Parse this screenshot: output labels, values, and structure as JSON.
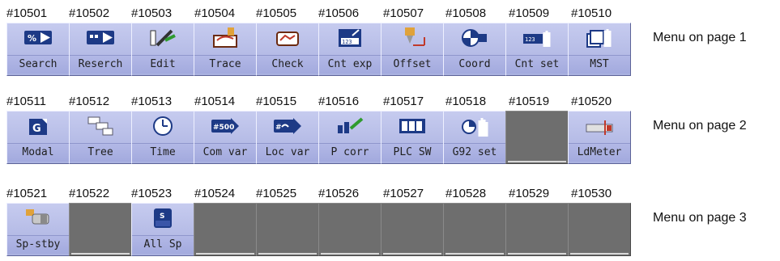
{
  "pages": [
    {
      "ids": [
        "#10501",
        "#10502",
        "#10503",
        "#10504",
        "#10505",
        "#10506",
        "#10507",
        "#10508",
        "#10509",
        "#10510"
      ],
      "caption": "Menu on page 1",
      "buttons": [
        {
          "label": "Search",
          "icon": "search-icon",
          "empty": false
        },
        {
          "label": "Reserch",
          "icon": "research-icon",
          "empty": false
        },
        {
          "label": "Edit",
          "icon": "edit-icon",
          "empty": false
        },
        {
          "label": "Trace",
          "icon": "trace-icon",
          "empty": false
        },
        {
          "label": "Check",
          "icon": "check-icon",
          "empty": false
        },
        {
          "label": "Cnt exp",
          "icon": "counter-expand-icon",
          "empty": false
        },
        {
          "label": "Offset",
          "icon": "offset-icon",
          "empty": false
        },
        {
          "label": "Coord",
          "icon": "coordinate-icon",
          "empty": false
        },
        {
          "label": "Cnt set",
          "icon": "counter-set-icon",
          "empty": false
        },
        {
          "label": "MST",
          "icon": "mst-icon",
          "empty": false
        }
      ]
    },
    {
      "ids": [
        "#10511",
        "#10512",
        "#10513",
        "#10514",
        "#10515",
        "#10516",
        "#10517",
        "#10518",
        "#10519",
        "#10520"
      ],
      "caption": "Menu on page 2",
      "buttons": [
        {
          "label": "Modal",
          "icon": "modal-icon",
          "empty": false
        },
        {
          "label": "Tree",
          "icon": "tree-icon",
          "empty": false
        },
        {
          "label": "Time",
          "icon": "clock-icon",
          "empty": false
        },
        {
          "label": "Com var",
          "icon": "common-variable-icon",
          "empty": false
        },
        {
          "label": "Loc var",
          "icon": "local-variable-icon",
          "empty": false
        },
        {
          "label": "P corr",
          "icon": "program-correction-icon",
          "empty": false
        },
        {
          "label": "PLC SW",
          "icon": "plc-switch-icon",
          "empty": false
        },
        {
          "label": "G92 set",
          "icon": "g92-set-icon",
          "empty": false
        },
        {
          "label": "",
          "icon": "",
          "empty": true
        },
        {
          "label": "LdMeter",
          "icon": "load-meter-icon",
          "empty": false
        }
      ]
    },
    {
      "ids": [
        "#10521",
        "#10522",
        "#10523",
        "#10524",
        "#10525",
        "#10526",
        "#10527",
        "#10528",
        "#10529",
        "#10530"
      ],
      "caption": "Menu on page 3",
      "buttons": [
        {
          "label": "Sp-stby",
          "icon": "spindle-standby-icon",
          "empty": false
        },
        {
          "label": "",
          "icon": "",
          "empty": true
        },
        {
          "label": "All Sp",
          "icon": "all-spindle-icon",
          "empty": false
        },
        {
          "label": "",
          "icon": "",
          "empty": true
        },
        {
          "label": "",
          "icon": "",
          "empty": true
        },
        {
          "label": "",
          "icon": "",
          "empty": true
        },
        {
          "label": "",
          "icon": "",
          "empty": true
        },
        {
          "label": "",
          "icon": "",
          "empty": true
        },
        {
          "label": "",
          "icon": "",
          "empty": true
        },
        {
          "label": "",
          "icon": "",
          "empty": true
        }
      ]
    }
  ]
}
